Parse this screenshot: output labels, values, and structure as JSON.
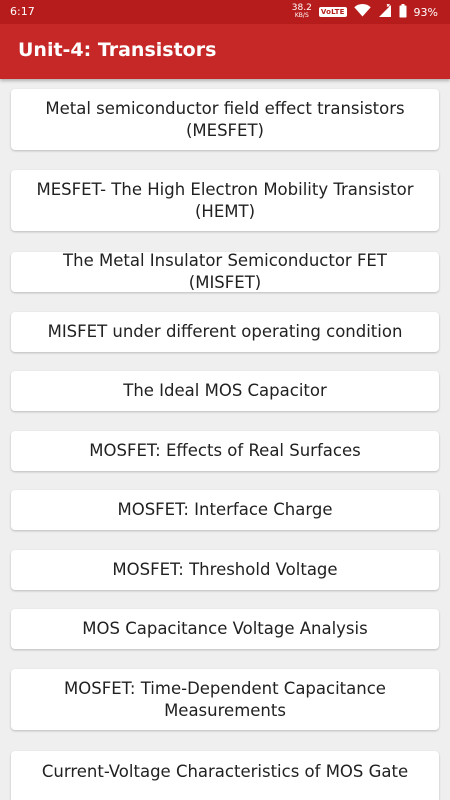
{
  "status_bar": {
    "time": "6:17",
    "net_speed_value": "38.2",
    "net_speed_unit": "KB/S",
    "volte_label": "VoLTE",
    "battery_percent": "93%"
  },
  "app_bar": {
    "title": "Unit-4: Transistors"
  },
  "topics": [
    "Metal semiconductor field effect transistors (MESFET)",
    "MESFET- The High Electron Mobility Transistor (HEMT)",
    "The Metal Insulator Semiconductor FET (MISFET)",
    "MISFET under different operating condition",
    "The Ideal MOS Capacitor",
    "MOSFET: Effects of Real Surfaces",
    "MOSFET: Interface Charge",
    "MOSFET: Threshold Voltage",
    "MOS Capacitance Voltage Analysis",
    "MOSFET: Time-Dependent Capacitance Measurements",
    "Current-Voltage Characteristics of MOS Gate"
  ],
  "colors": {
    "status_bar": "#b71c1c",
    "app_bar": "#c62828",
    "background": "#efefef",
    "card": "#ffffff",
    "text": "#212121"
  },
  "icons": {
    "wifi": "wifi-icon",
    "signal": "signal-icon",
    "battery": "battery-icon"
  }
}
